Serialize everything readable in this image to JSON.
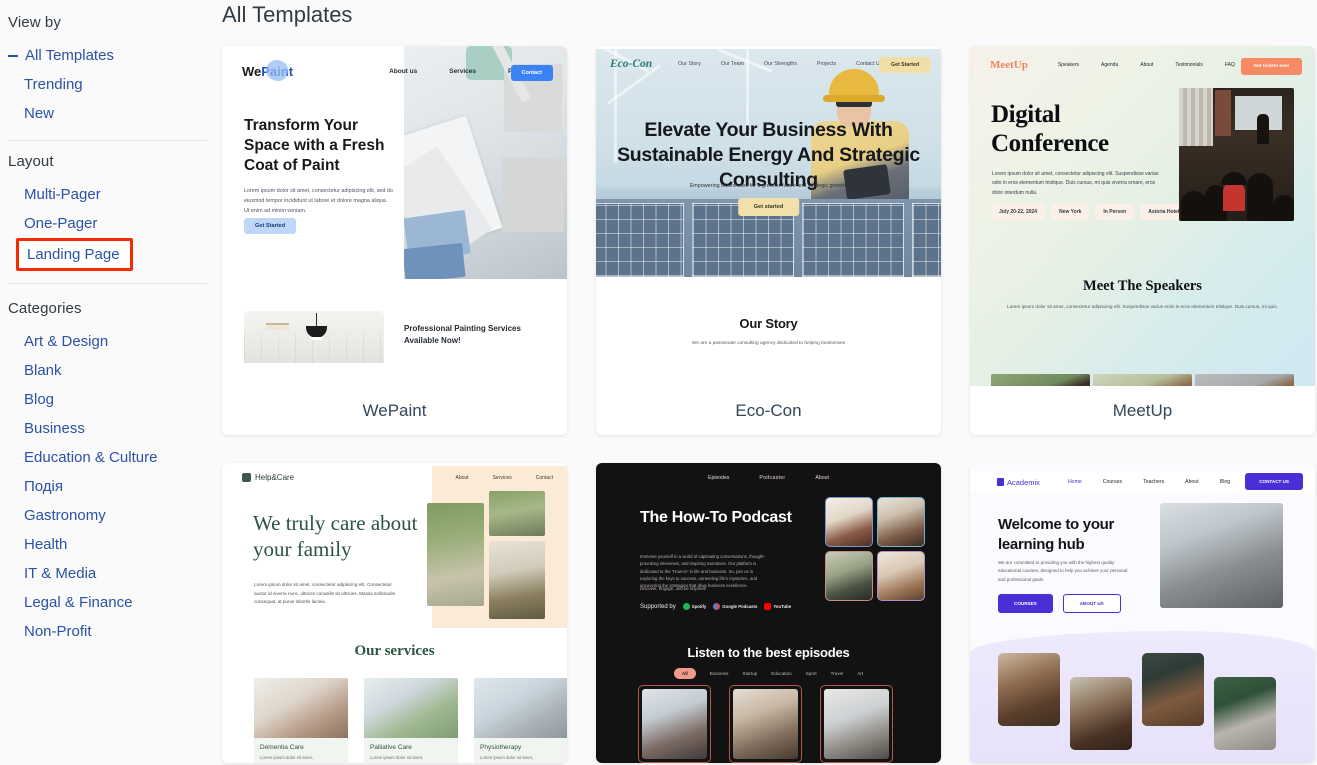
{
  "sidebar": {
    "view_by_label": "View by",
    "view_items": [
      {
        "label": "All Templates",
        "expanded_marker": "–"
      },
      {
        "label": "Trending"
      },
      {
        "label": "New"
      }
    ],
    "layout_label": "Layout",
    "layout_items": [
      {
        "label": "Multi-Pager"
      },
      {
        "label": "One-Pager"
      },
      {
        "label": "Landing Page",
        "highlighted": true
      }
    ],
    "categories_label": "Categories",
    "category_items": [
      {
        "label": "Art & Design"
      },
      {
        "label": "Blank"
      },
      {
        "label": "Blog"
      },
      {
        "label": "Business"
      },
      {
        "label": "Education & Culture"
      },
      {
        "label": "Подія"
      },
      {
        "label": "Gastronomy"
      },
      {
        "label": "Health"
      },
      {
        "label": "IT & Media"
      },
      {
        "label": "Legal & Finance"
      },
      {
        "label": "Non-Profit"
      }
    ],
    "highlight_color": "#f62c00",
    "link_color": "#2c51a5"
  },
  "main": {
    "title": "All Templates"
  },
  "templates": [
    {
      "name": "WePaint",
      "logo_primary": "We",
      "logo_secondary": "Paint",
      "nav": [
        "About us",
        "Services",
        "Projects"
      ],
      "nav_cta": "Contact",
      "headline": "Transform Your Space with a Fresh Coat of Paint",
      "body": "Lorem ipsum dolor sit amet, consectetur adipiscing elit, sed do eiusmod tempor incididunt ut labore et dolore magna aliqua. Ut enim ad minim veniam.",
      "cta": "Get Started",
      "section_caption": "Professional Painting Services Available Now!"
    },
    {
      "name": "Eco-Con",
      "logo_primary": "Eco-Con",
      "nav": [
        "Our Story",
        "Our Team",
        "Our Strengths",
        "Projects",
        "Contact Us"
      ],
      "nav_cta": "Get Started",
      "headline": "Elevate Your Business With Sustainable Energy And Strategic Consulting",
      "subheadline": "Empowering businesses for a greener future and strategic growth.",
      "cta": "Get started",
      "section_title": "Our Story",
      "section_body": "We are a passionate consulting agency dedicated to helping businesses"
    },
    {
      "name": "MeetUp",
      "logo_primary": "MeetUp",
      "nav": [
        "Speakers",
        "Agenda",
        "About",
        "Testimonials",
        "FAQ"
      ],
      "nav_cta": "Get tickets now",
      "headline": "Digital Conference",
      "body": "Lorem ipsum dolor sit amet, consectetur adipiscing elit. Suspendisse varias odio in eros elementum tristique. Duis cursus, mi quis viverra ornare, eros dolor interdum nulla.",
      "tags": [
        "July 20-22, 2024",
        "New York",
        "In Person",
        "Astoria Hotel"
      ],
      "section_title": "Meet The Speakers",
      "section_body": "Lorem ipsum dolor sit amet, consectetur adipiscing elit. Suspendisse varius enim in eros elementum tristique. Duis cursus, mi quis."
    },
    {
      "name": "Help&Care",
      "logo_primary": "Help&Care",
      "nav": [
        "About",
        "Services",
        "Contact"
      ],
      "headline": "We truly care about your family",
      "body": "Lorem ipsum dolor sit amet, consectetur adipiscing elit. Consectetur auctor id viverra nunc, ultrices convallis sit ultricies. Massa sollicitudin consequat, at purus lobortis lacinia.",
      "section_title": "Our services",
      "services": [
        {
          "title": "Dementia Care",
          "desc": "Lorem ipsum dolor sit amet,"
        },
        {
          "title": "Palliative Care",
          "desc": "Lorem ipsum dolor sit amet,"
        },
        {
          "title": "Physiotherapy",
          "desc": "Lorem ipsum dolor sit amet,"
        }
      ]
    },
    {
      "name": "Podcaster",
      "logo_primary": "Podcaster",
      "nav_left": "Episodes",
      "nav_right": "About",
      "headline": "The How-To Podcast",
      "body": "Immerse yourself in a world of captivating conversations, thought-provoking interviews, and inspiring narratives. Our platform is dedicated to the \"How-to\" in life and business. So, join us in exploring the keys to success, unraveling life's mysteries, and uncovering the strategies that drive business excellence.",
      "body2": "Discover, engage, and be inspired!",
      "supported_label": "Supported by",
      "supported": [
        "Spotify",
        "Google Podcasts",
        "YouTube"
      ],
      "section_title": "Listen to the best episodes",
      "episode_tabs": [
        "All",
        "Business",
        "Startup",
        "Education",
        "Sport",
        "Travel",
        "Art"
      ]
    },
    {
      "name": "Academix",
      "logo_primary": "Academix",
      "nav": [
        "Home",
        "Courses",
        "Teachers",
        "About",
        "Blog"
      ],
      "nav_cta": "CONTACT US",
      "headline": "Welcome to your learning hub",
      "body": "We are committed to providing you with the highest quality educational courses, designed to help you achieve your personal and professional goals.",
      "cta_primary": "COURSES",
      "cta_secondary": "ABOUT US"
    }
  ]
}
